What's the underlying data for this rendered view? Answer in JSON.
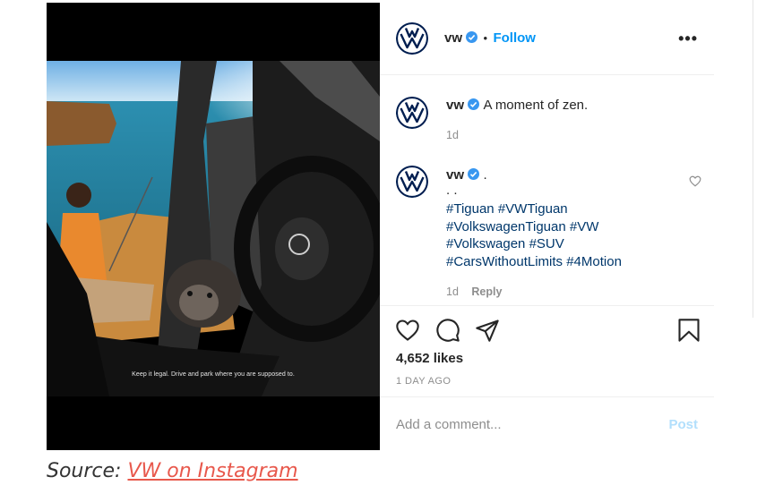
{
  "post": {
    "image_caption": "Keep it legal. Drive and park where you are supposed to.",
    "header": {
      "username": "vw",
      "separator": "•",
      "follow_label": "Follow",
      "more_label": "•••"
    },
    "caption": {
      "username": "vw",
      "text": "A moment of zen.",
      "time": "1d"
    },
    "comment": {
      "username": "vw",
      "first_line": ".",
      "second_line": ". .",
      "hashtag_lines": [
        "#Tiguan #VWTiguan",
        "#VolkswagenTiguan #VW",
        "#Volkswagen #SUV",
        "#CarsWithoutLimits #4Motion"
      ],
      "time": "1d",
      "reply_label": "Reply"
    },
    "likes": "4,652 likes",
    "posted_ago": "1 DAY AGO",
    "add_comment": {
      "placeholder": "Add a comment...",
      "post_label": "Post"
    }
  },
  "source": {
    "label": "Source:",
    "link_text": "VW on Instagram"
  },
  "colors": {
    "accent": "#0095f6",
    "verified": "#3897f0",
    "hashtag": "#00376b",
    "muted": "#8e8e8e",
    "source_link": "#e8584c"
  },
  "icons": [
    "vw-logo-icon",
    "verified-badge-icon",
    "more-icon",
    "heart-icon",
    "comment-icon",
    "share-icon",
    "bookmark-icon"
  ]
}
